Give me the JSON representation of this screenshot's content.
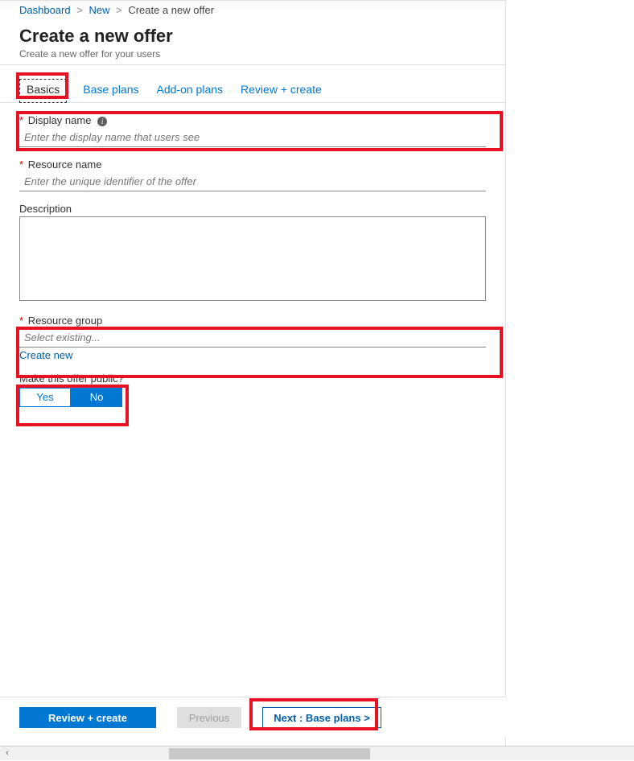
{
  "breadcrumb": {
    "items": [
      "Dashboard",
      "New",
      "Create a new offer"
    ]
  },
  "header": {
    "title": "Create a new offer",
    "subtitle": "Create a new offer for your users"
  },
  "tabs": [
    "Basics",
    "Base plans",
    "Add-on plans",
    "Review + create"
  ],
  "fields": {
    "display_name": {
      "label": "Display name",
      "placeholder": "Enter the display name that users see"
    },
    "resource_name": {
      "label": "Resource name",
      "placeholder": "Enter the unique identifier of the offer"
    },
    "description": {
      "label": "Description"
    },
    "resource_group": {
      "label": "Resource group",
      "placeholder": "Select existing...",
      "create_link": "Create new"
    },
    "public": {
      "label": "Make this offer public?",
      "yes": "Yes",
      "no": "No"
    }
  },
  "footer": {
    "review": "Review + create",
    "previous": "Previous",
    "next": "Next : Base plans >"
  }
}
